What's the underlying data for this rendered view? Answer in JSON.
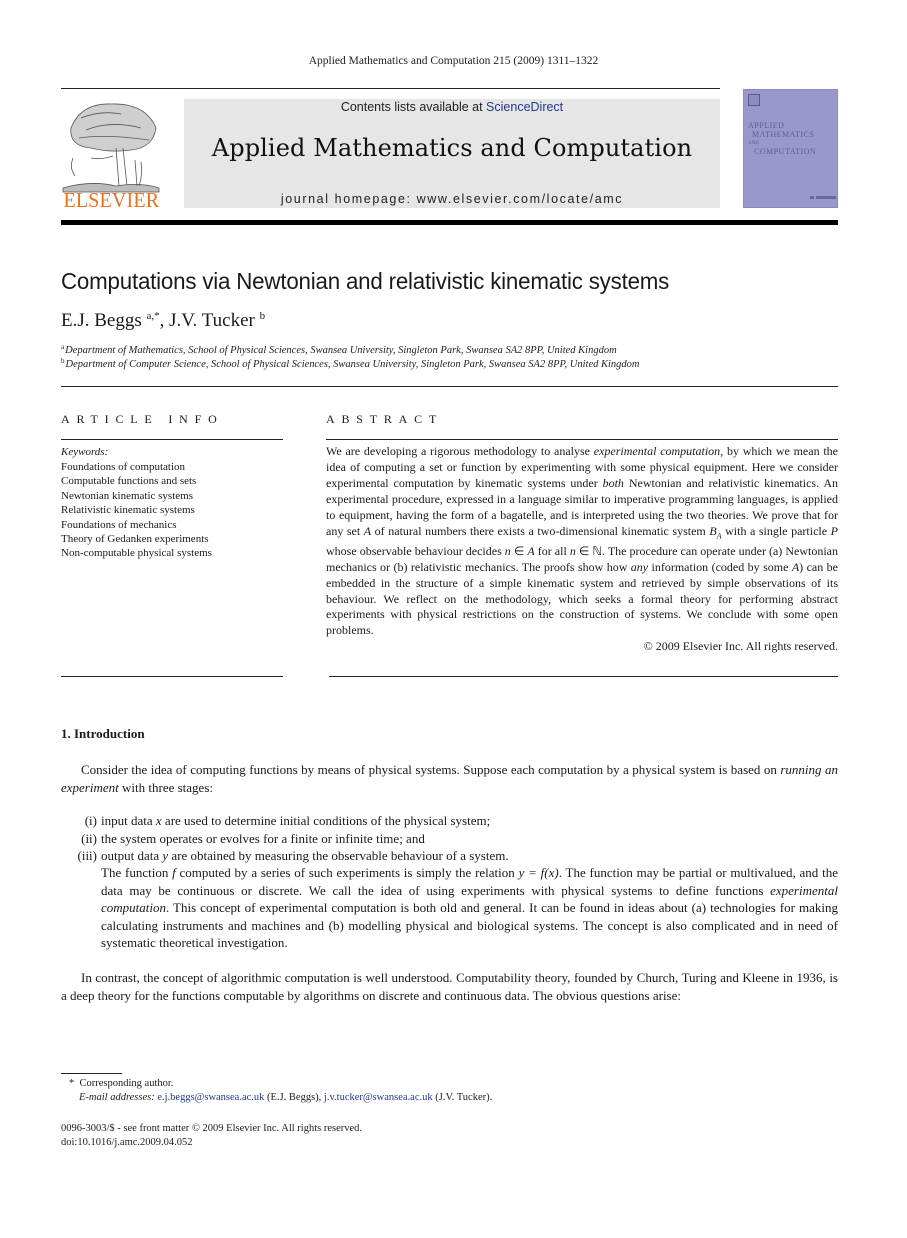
{
  "running_head": "Applied Mathematics and Computation 215 (2009) 1311–1322",
  "publisher": {
    "logo_icon": "elsevier-tree-icon",
    "name": "ELSEVIER",
    "brand_color": "#e9711c"
  },
  "banner": {
    "contents_prefix": "Contents lists available at ",
    "contents_link": "ScienceDirect",
    "journal_title": "Applied Mathematics and Computation",
    "homepage": "journal homepage: www.elsevier.com/locate/amc",
    "background_color": "#e6e6e6",
    "link_color": "#1f3a8a"
  },
  "cover": {
    "line1": "APPLIED",
    "line2": "MATHEMATICS",
    "line3": "AND",
    "line4": "COMPUTATION",
    "color": "#9898cc"
  },
  "article": {
    "title": "Computations via Newtonian and relativistic kinematic systems",
    "authors": [
      {
        "name": "E.J. Beggs",
        "sup": "a,*"
      },
      {
        "name": "J.V. Tucker",
        "sup": "b"
      }
    ],
    "affiliations": [
      {
        "sup": "a",
        "text": "Department of Mathematics, School of Physical Sciences, Swansea University, Singleton Park, Swansea SA2 8PP, United Kingdom"
      },
      {
        "sup": "b",
        "text": "Department of Computer Science, School of Physical Sciences, Swansea University, Singleton Park, Swansea SA2 8PP, United Kingdom"
      }
    ]
  },
  "article_info": {
    "heading": "ARTICLE INFO",
    "keywords_label": "Keywords:",
    "keywords": [
      "Foundations of computation",
      "Computable functions and sets",
      "Newtonian kinematic systems",
      "Relativistic kinematic systems",
      "Foundations of mechanics",
      "Theory of Gedanken experiments",
      "Non-computable physical systems"
    ]
  },
  "abstract": {
    "heading": "ABSTRACT",
    "parts": {
      "p1": "We are developing a rigorous methodology to analyse ",
      "i1": "experimental computation",
      "p2": ", by which we mean the idea of computing a set or function by experimenting with some physical equipment. Here we consider experimental computation by kinematic systems under ",
      "i2": "both",
      "p3": " Newtonian and relativistic kinematics. An experimental procedure, expressed in a language similar to imperative programming languages, is applied to equipment, having the form of a bagatelle, and is interpreted using the two theories. We prove that for any set ",
      "i3": "A",
      "p4": " of natural numbers there exists a two-dimensional kinematic system ",
      "i4": "B",
      "i4sub": "A",
      "p5": " with a single particle ",
      "i5": "P",
      "p6": " whose observable behaviour decides ",
      "i6": "n",
      "p7": " ∈ ",
      "i7": "A",
      "p8": " for all ",
      "i8": "n",
      "p9": " ∈ ℕ. The procedure can operate under (a) Newtonian mechanics or (b) relativistic mechanics. The proofs show how ",
      "i9": "any",
      "p10": " information (coded by some ",
      "i10": "A",
      "p11": ") can be embedded in the structure of a simple kinematic system and retrieved by simple observations of its behaviour. We reflect on the methodology, which seeks a formal theory for performing abstract experiments with physical restrictions on the construction of systems. We conclude with some open problems."
    },
    "copyright": "© 2009 Elsevier Inc. All rights reserved."
  },
  "introduction": {
    "heading": "1.  Introduction",
    "para1_a": "Consider the idea of computing functions by means of physical systems. Suppose each computation by a physical system is based on ",
    "para1_i": "running an experiment",
    "para1_b": " with three stages:",
    "stages": [
      {
        "num": "(i)",
        "a": "input data ",
        "v": "x",
        "b": " are used to determine initial conditions of the physical system;"
      },
      {
        "num": "(ii)",
        "a": "the system operates or evolves for a finite or infinite time; and",
        "v": "",
        "b": ""
      },
      {
        "num": "(iii)",
        "a": "output data ",
        "v": "y",
        "b": " are obtained by measuring the observable behaviour of a system."
      }
    ],
    "para2": {
      "a": "The function ",
      "f": "f",
      "b": " computed by a series of such experiments is simply the relation ",
      "eq": "y = f(x)",
      "c": ". The function may be partial or multivalued, and the data may be continuous or discrete. We call the idea of using experiments with physical systems to define functions ",
      "i": "experimental computation",
      "d": ". This concept of experimental computation is both old and general. It can be found in ideas about (a) technologies for making calculating instruments and machines and (b) modelling physical and biological systems. The concept is also complicated and in need of systematic theoretical investigation."
    },
    "para3": "In contrast, the concept of algorithmic computation is well understood. Computability theory, founded by Church, Turing and Kleene in 1936, is a deep theory for the functions computable by algorithms on discrete and continuous data. The obvious questions arise:"
  },
  "footnotes": {
    "star": "*",
    "corresponding": "Corresponding author.",
    "email_label": "E-mail addresses:",
    "email1": "e.j.beggs@swansea.ac.uk",
    "email1_who": " (E.J. Beggs), ",
    "email2": "j.v.tucker@swansea.ac.uk",
    "email2_who": " (J.V. Tucker)."
  },
  "front_matter": {
    "issn_line": "0096-3003/$ - see front matter © 2009 Elsevier Inc. All rights reserved.",
    "doi": "doi:10.1016/j.amc.2009.04.052"
  }
}
